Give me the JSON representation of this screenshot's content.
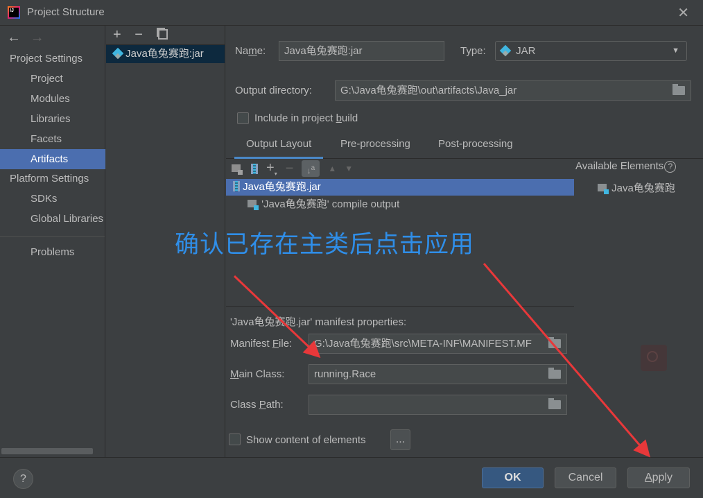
{
  "window": {
    "title": "Project Structure",
    "close": "✕"
  },
  "nav": {
    "back": "←",
    "forward": "→",
    "project_settings": "Project Settings",
    "project_items": [
      "Project",
      "Modules",
      "Libraries",
      "Facets",
      "Artifacts"
    ],
    "platform_settings": "Platform Settings",
    "platform_items": [
      "SDKs",
      "Global Libraries"
    ],
    "problems": "Problems",
    "selected": "Artifacts"
  },
  "artifacts_list": {
    "add": "+",
    "remove": "−",
    "items": [
      "Java龟兔赛跑:jar"
    ]
  },
  "form": {
    "name_label_pre": "Na",
    "name_label_u": "m",
    "name_label_post": "e:",
    "name_value": "Java龟兔赛跑:jar",
    "type_label": "Type:",
    "type_value": "JAR",
    "output_dir_label": "Output directory:",
    "output_dir_value": "G:\\Java龟兔赛跑\\out\\artifacts\\Java_jar",
    "include_pre": "Include in project ",
    "include_u": "b",
    "include_post": "uild",
    "include_checked": false
  },
  "tabs": [
    {
      "label": "Output Layout",
      "active": true
    },
    {
      "label": "Pre-processing"
    },
    {
      "label": "Post-processing"
    }
  ],
  "layout_tree": [
    {
      "label": "Java龟兔赛跑.jar",
      "selected": true
    },
    {
      "label": "'Java龟兔赛跑' compile output"
    }
  ],
  "available": {
    "title": "Available Elements",
    "help": "?",
    "items": [
      "Java龟兔赛跑"
    ]
  },
  "manifest": {
    "title": "'Java龟兔赛跑.jar' manifest properties:",
    "file_label_pre": "Manifest ",
    "file_label_u": "F",
    "file_label_post": "ile:",
    "file_value": "G:\\Java龟兔赛跑\\src\\META-INF\\MANIFEST.MF",
    "main_label_u": "M",
    "main_label_post": "ain Class:",
    "main_value": "running.Race",
    "cp_label_pre": "Class ",
    "cp_label_u": "P",
    "cp_label_post": "ath:",
    "cp_value": "",
    "show_content": "Show content of elements",
    "show_checked": false,
    "ellipsis": "..."
  },
  "annotation": {
    "text": "确认已存在主类后点击应用",
    "color": "#2f8ee8",
    "arrow_color": "#e8383a"
  },
  "footer": {
    "help": "?",
    "ok": "OK",
    "cancel": "Cancel",
    "apply_u": "A",
    "apply_post": "pply"
  },
  "colors": {
    "accent": "#4b6eaf",
    "background": "#3c3f41",
    "ok_button": "#365880"
  }
}
